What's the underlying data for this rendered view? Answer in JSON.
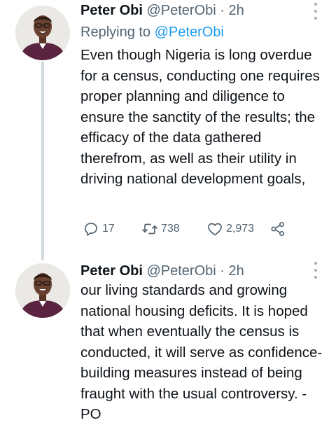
{
  "tweets": [
    {
      "author_name": "Peter Obi",
      "handle": "@PeterObi",
      "separator": "·",
      "time": "2h",
      "reply_prefix": "Replying to",
      "reply_mention": "@PeterObi",
      "text": "Even though Nigeria is long overdue for a census, conducting one requires proper planning and diligence to ensure the sanctity of the results; the efficacy of the data gathered therefrom, as well as their utility in driving national development goals,",
      "reply_count": "17",
      "retweet_count": "738",
      "like_count": "2,973"
    },
    {
      "author_name": "Peter Obi",
      "handle": "@PeterObi",
      "separator": "·",
      "time": "2h",
      "text": "our living standards and growing national housing deficits. It is hoped that when eventually the census is conducted, it will serve as confidence-building measures instead of being fraught with the usual controversy. -PO"
    }
  ],
  "icons": {
    "reply": "reply-icon",
    "retweet": "retweet-icon",
    "like": "heart-icon",
    "share": "share-icon",
    "more": "more-vertical-icon"
  },
  "colors": {
    "text": "#0f1419",
    "secondary": "#536471",
    "link": "#1d9bf0",
    "thread_line": "#cfd9de"
  }
}
